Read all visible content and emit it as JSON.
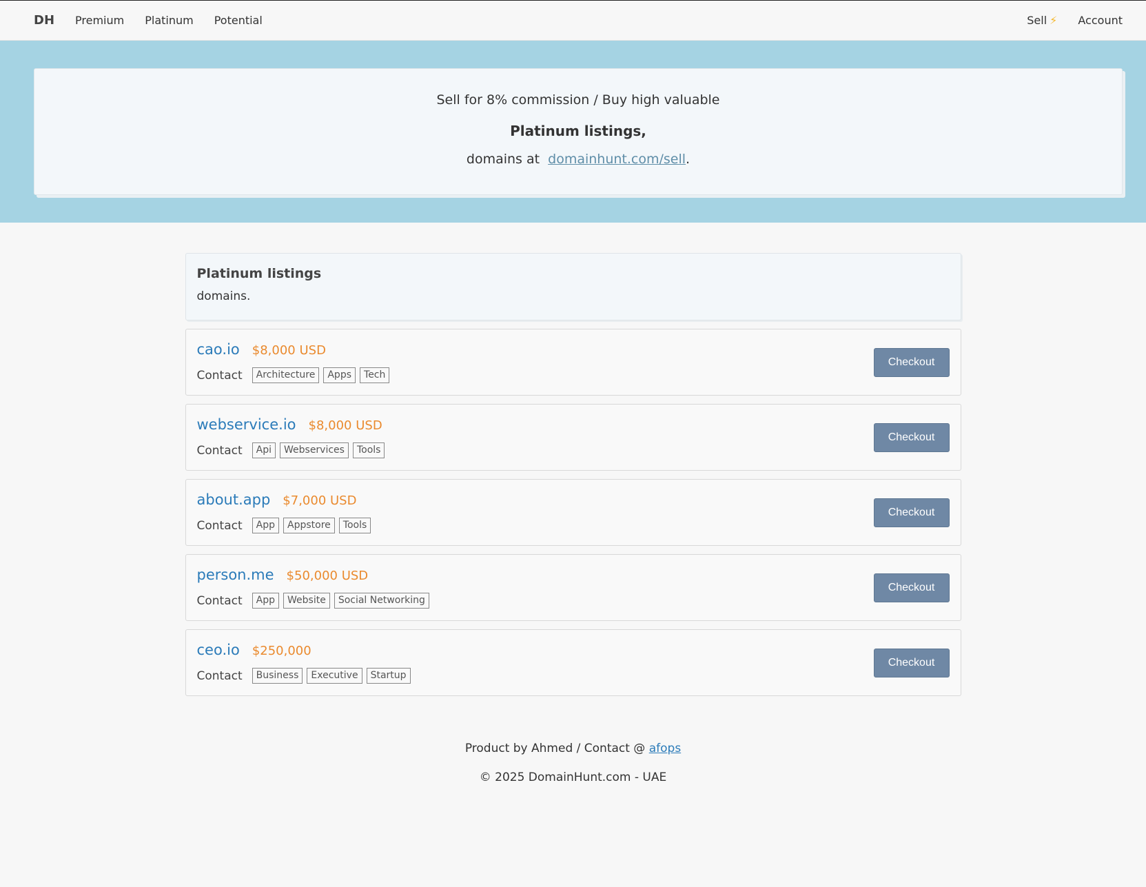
{
  "nav": {
    "brand": "DH",
    "links": [
      "Premium",
      "Platinum",
      "Potential"
    ],
    "sell": "Sell",
    "bolt": "⚡",
    "account": "Account"
  },
  "hero": {
    "line1": "Sell for 8% commission / Buy high valuable",
    "line2": "Platinum listings,",
    "line3_prefix": "domains at",
    "link": "domainhunt.com/sell",
    "line3_suffix": "."
  },
  "info": {
    "title": "Platinum listings",
    "subtitle": "domains."
  },
  "listings": [
    {
      "domain": "cao.io",
      "price": "$8,000 USD",
      "contact": "Contact",
      "tags": [
        "Architecture",
        "Apps",
        "Tech"
      ],
      "button": "Checkout"
    },
    {
      "domain": "webservice.io",
      "price": "$8,000 USD",
      "contact": "Contact",
      "tags": [
        "Api",
        "Webservices",
        "Tools"
      ],
      "button": "Checkout"
    },
    {
      "domain": "about.app",
      "price": "$7,000 USD",
      "contact": "Contact",
      "tags": [
        "App",
        "Appstore",
        "Tools"
      ],
      "button": "Checkout"
    },
    {
      "domain": "person.me",
      "price": "$50,000 USD",
      "contact": "Contact",
      "tags": [
        "App",
        "Website",
        "Social Networking"
      ],
      "button": "Checkout"
    },
    {
      "domain": "ceo.io",
      "price": "$250,000",
      "contact": "Contact",
      "tags": [
        "Business",
        "Executive",
        "Startup"
      ],
      "button": "Checkout"
    }
  ],
  "footer": {
    "line1_prefix": "Product by Ahmed / Contact @",
    "line1_link": "afops",
    "line2": "© 2025  DomainHunt.com - UAE"
  },
  "colors": {
    "hero_bg": "#a5d3e3",
    "domain": "#2b7bb9",
    "price": "#ea8a2e",
    "button": "#6f88a5"
  }
}
